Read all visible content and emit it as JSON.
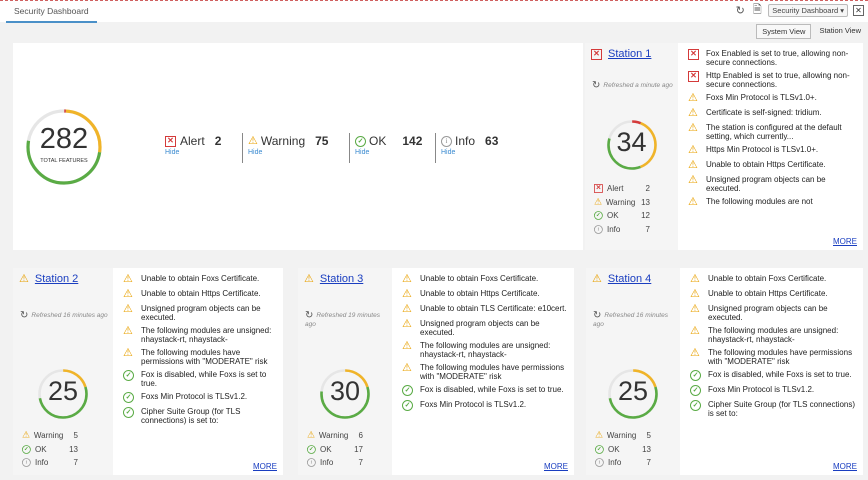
{
  "tab": {
    "label": "Security Dashboard"
  },
  "toolbar": {
    "view_select": "Security Dashboard ▾"
  },
  "views": {
    "system": "System View",
    "station": "Station View"
  },
  "colors": {
    "alert": "#d43a3a",
    "warning": "#f0b429",
    "ok": "#5aab45",
    "info": "#999999",
    "link": "#1a3ec0"
  },
  "summary": {
    "total": 282,
    "total_label": "TOTAL FEATURES",
    "alert": {
      "label": "Alert",
      "count": 2,
      "hide": "Hide"
    },
    "warning": {
      "label": "Warning",
      "count": 75,
      "hide": "Hide"
    },
    "ok": {
      "label": "OK",
      "count": 142,
      "hide": "Hide"
    },
    "info": {
      "label": "Info",
      "count": 63,
      "hide": "Hide"
    }
  },
  "stations": [
    {
      "name": "Station 1",
      "status_icon": "alert-icon",
      "refreshed": "Refreshed a minute ago",
      "total": 34,
      "counts": [
        {
          "label": "Alert",
          "value": 2,
          "icon": "alert-icon"
        },
        {
          "label": "Warning",
          "value": 13,
          "icon": "warning-icon"
        },
        {
          "label": "OK",
          "value": 12,
          "icon": "ok-icon"
        },
        {
          "label": "Info",
          "value": 7,
          "icon": "info-icon"
        }
      ],
      "issues": [
        {
          "icon": "alert-icon",
          "text": "Fox Enabled is set to true, allowing non-secure connections."
        },
        {
          "icon": "alert-icon",
          "text": "Http Enabled is set to true, allowing non-secure connections."
        },
        {
          "icon": "warning-icon",
          "text": "Foxs Min Protocol is TLSv1.0+."
        },
        {
          "icon": "warning-icon",
          "text": "Certificate is self-signed: tridium."
        },
        {
          "icon": "warning-icon",
          "text": "The station is configured at the default setting, which currently..."
        },
        {
          "icon": "warning-icon",
          "text": "Https Min Protocol is TLSv1.0+."
        },
        {
          "icon": "warning-icon",
          "text": "Unable to obtain Https Certificate."
        },
        {
          "icon": "warning-icon",
          "text": "Unsigned program objects can be executed."
        },
        {
          "icon": "warning-icon",
          "text": "The following modules are not"
        }
      ],
      "more": "MORE"
    },
    {
      "name": "Station 2",
      "status_icon": "warning-icon",
      "refreshed": "Refreshed 16 minutes ago",
      "total": 25,
      "counts": [
        {
          "label": "Warning",
          "value": 5,
          "icon": "warning-icon"
        },
        {
          "label": "OK",
          "value": 13,
          "icon": "ok-icon"
        },
        {
          "label": "Info",
          "value": 7,
          "icon": "info-icon"
        }
      ],
      "issues": [
        {
          "icon": "warning-icon",
          "text": "Unable to obtain Foxs Certificate."
        },
        {
          "icon": "warning-icon",
          "text": "Unable to obtain Https Certificate."
        },
        {
          "icon": "warning-icon",
          "text": "Unsigned program objects can be executed."
        },
        {
          "icon": "warning-icon",
          "text": "The following modules are unsigned: nhaystack-rt, nhaystack-"
        },
        {
          "icon": "warning-icon",
          "text": "The following modules have permissions with \"MODERATE\" risk"
        },
        {
          "icon": "ok-icon",
          "text": "Fox is disabled, while Foxs is set to true."
        },
        {
          "icon": "ok-icon",
          "text": "Foxs Min Protocol is TLSv1.2."
        },
        {
          "icon": "ok-icon",
          "text": "Cipher Suite Group (for TLS connections) is set to:"
        }
      ],
      "more": "MORE"
    },
    {
      "name": "Station 3",
      "status_icon": "warning-icon",
      "refreshed": "Refreshed 19 minutes ago",
      "total": 30,
      "counts": [
        {
          "label": "Warning",
          "value": 6,
          "icon": "warning-icon"
        },
        {
          "label": "OK",
          "value": 17,
          "icon": "ok-icon"
        },
        {
          "label": "Info",
          "value": 7,
          "icon": "info-icon"
        }
      ],
      "issues": [
        {
          "icon": "warning-icon",
          "text": "Unable to obtain Foxs Certificate."
        },
        {
          "icon": "warning-icon",
          "text": "Unable to obtain Https Certificate."
        },
        {
          "icon": "warning-icon",
          "text": "Unable to obtain TLS Certificate: e10cert."
        },
        {
          "icon": "warning-icon",
          "text": "Unsigned program objects can be executed."
        },
        {
          "icon": "warning-icon",
          "text": "The following modules are unsigned: nhaystack-rt, nhaystack-"
        },
        {
          "icon": "warning-icon",
          "text": "The following modules have permissions with \"MODERATE\" risk"
        },
        {
          "icon": "ok-icon",
          "text": "Fox is disabled, while Foxs is set to true."
        },
        {
          "icon": "ok-icon",
          "text": "Foxs Min Protocol is TLSv1.2."
        }
      ],
      "more": "MORE"
    },
    {
      "name": "Station 4",
      "status_icon": "warning-icon",
      "refreshed": "Refreshed 16 minutes ago",
      "total": 25,
      "counts": [
        {
          "label": "Warning",
          "value": 5,
          "icon": "warning-icon"
        },
        {
          "label": "OK",
          "value": 13,
          "icon": "ok-icon"
        },
        {
          "label": "Info",
          "value": 7,
          "icon": "info-icon"
        }
      ],
      "issues": [
        {
          "icon": "warning-icon",
          "text": "Unable to obtain Foxs Certificate."
        },
        {
          "icon": "warning-icon",
          "text": "Unable to obtain Https Certificate."
        },
        {
          "icon": "warning-icon",
          "text": "Unsigned program objects can be executed."
        },
        {
          "icon": "warning-icon",
          "text": "The following modules are unsigned: nhaystack-rt, nhaystack-"
        },
        {
          "icon": "warning-icon",
          "text": "The following modules have permissions with \"MODERATE\" risk"
        },
        {
          "icon": "ok-icon",
          "text": "Fox is disabled, while Foxs is set to true."
        },
        {
          "icon": "ok-icon",
          "text": "Foxs Min Protocol is TLSv1.2."
        },
        {
          "icon": "ok-icon",
          "text": "Cipher Suite Group (for TLS connections) is set to:"
        }
      ],
      "more": "MORE"
    }
  ]
}
